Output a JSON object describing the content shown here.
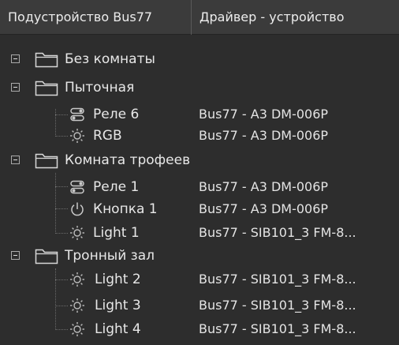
{
  "columns": {
    "device": "Подустройство Bus77",
    "driver": "Драйвер - устройство"
  },
  "rooms": [
    {
      "name": "Без комнаты",
      "expanded": true,
      "devices": []
    },
    {
      "name": "Пыточная",
      "expanded": true,
      "devices": [
        {
          "name": "Реле 6",
          "icon": "relay-icon",
          "driver": "Bus77 - A3 DM-006P"
        },
        {
          "name": "RGB",
          "icon": "light-icon",
          "driver": "Bus77 - A3 DM-006P"
        }
      ]
    },
    {
      "name": "Комната трофеев",
      "expanded": true,
      "devices": [
        {
          "name": "Реле 1",
          "icon": "relay-icon",
          "driver": "Bus77 - A3 DM-006P"
        },
        {
          "name": "Кнопка 1",
          "icon": "power-button-icon",
          "driver": "Bus77 - A3 DM-006P"
        },
        {
          "name": "Light 1",
          "icon": "light-icon",
          "driver": "Bus77 - SIB101_3 FM-8..."
        }
      ]
    },
    {
      "name": "Тронный зал",
      "expanded": true,
      "devices": [
        {
          "name": "Light 2",
          "icon": "light-icon",
          "driver": "Bus77 - SIB101_3 FM-8..."
        },
        {
          "name": "Light 3",
          "icon": "light-icon",
          "driver": "Bus77 - SIB101_3 FM-8..."
        },
        {
          "name": "Light 4",
          "icon": "light-icon",
          "driver": "Bus77 - SIB101_3 FM-8..."
        }
      ]
    }
  ]
}
